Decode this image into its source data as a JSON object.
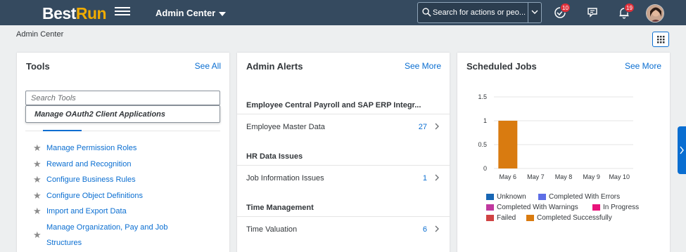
{
  "shell": {
    "logo_part1": "Best",
    "logo_part2": "Run",
    "app_title": "Admin Center",
    "search_placeholder": "Search for actions or peo...",
    "todo_badge": "10",
    "notif_badge": "19",
    "icons": [
      "search-icon",
      "chevron-down-icon",
      "todo-check-icon",
      "feedback-icon",
      "bell-icon",
      "avatar"
    ]
  },
  "breadcrumb": "Admin Center",
  "tools": {
    "title": "Tools",
    "see_all": "See All",
    "search_placeholder": "Search Tools",
    "suggestion": "Manage OAuth2 Client Applications",
    "items": [
      "Manage Permission Roles",
      "Reward and Recognition",
      "Configure Business Rules",
      "Configure Object Definitions",
      "Import and Export Data",
      "Manage Organization, Pay and Job Structures"
    ]
  },
  "alerts": {
    "title": "Admin Alerts",
    "see_more": "See More",
    "sections": [
      {
        "title": "Employee Central Payroll and SAP ERP Integr...",
        "row": "Employee Master Data",
        "count": "27"
      },
      {
        "title": "HR Data Issues",
        "row": "Job Information Issues",
        "count": "1"
      },
      {
        "title": "Time Management",
        "row": "Time Valuation",
        "count": "6"
      }
    ]
  },
  "jobs": {
    "title": "Scheduled Jobs",
    "see_more": "See More"
  },
  "chart_data": {
    "type": "bar",
    "categories": [
      "May 6",
      "May 7",
      "May 8",
      "May 9",
      "May 10"
    ],
    "ylim": [
      0,
      1.5
    ],
    "yticks": [
      "1.5",
      "1",
      "0.5",
      "0"
    ],
    "series": [
      {
        "name": "Unknown",
        "color": "#1866b4",
        "values": [
          0,
          0,
          0,
          0,
          0
        ]
      },
      {
        "name": "Completed With Errors",
        "color": "#5d6ee6",
        "values": [
          0,
          0,
          0,
          0,
          0
        ]
      },
      {
        "name": "Completed With Warnings",
        "color": "#c0399f",
        "values": [
          0,
          0,
          0,
          0,
          0
        ]
      },
      {
        "name": "In Progress",
        "color": "#e8127a",
        "values": [
          0,
          0,
          0,
          0,
          0
        ]
      },
      {
        "name": "Failed",
        "color": "#d04343",
        "values": [
          0,
          0,
          0,
          0,
          0
        ]
      },
      {
        "name": "Completed Successfully",
        "color": "#d97b10",
        "values": [
          1,
          0,
          0,
          0,
          0
        ]
      }
    ],
    "legend_placement": "bottom"
  }
}
